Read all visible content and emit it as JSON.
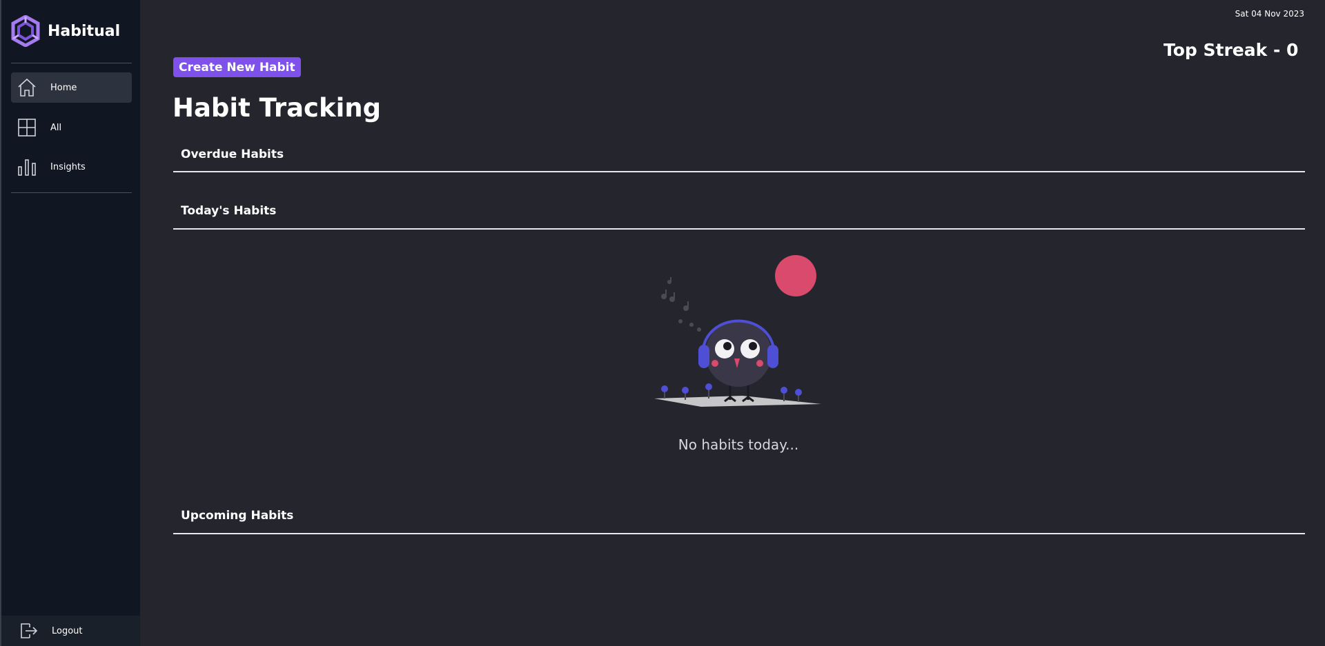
{
  "app": {
    "name": "Habitual"
  },
  "sidebar": {
    "items": [
      {
        "label": "Home",
        "icon": "home-icon",
        "active": true
      },
      {
        "label": "All",
        "icon": "grid-icon",
        "active": false
      },
      {
        "label": "Insights",
        "icon": "bar-chart-icon",
        "active": false
      }
    ],
    "logout_label": "Logout"
  },
  "header": {
    "date": "Sat 04 Nov 2023",
    "top_streak": "Top Streak - 0",
    "create_button": "Create New Habit",
    "title": "Habit Tracking"
  },
  "sections": {
    "overdue": "Overdue Habits",
    "today": "Today's Habits",
    "upcoming": "Upcoming Habits"
  },
  "empty_state": {
    "text": "No habits today..."
  },
  "colors": {
    "accent": "#7d51ea",
    "sidebar_bg": "#111722",
    "main_bg": "#24252d",
    "illustration_pink": "#d94a6c",
    "illustration_blue": "#4f4fd6"
  }
}
